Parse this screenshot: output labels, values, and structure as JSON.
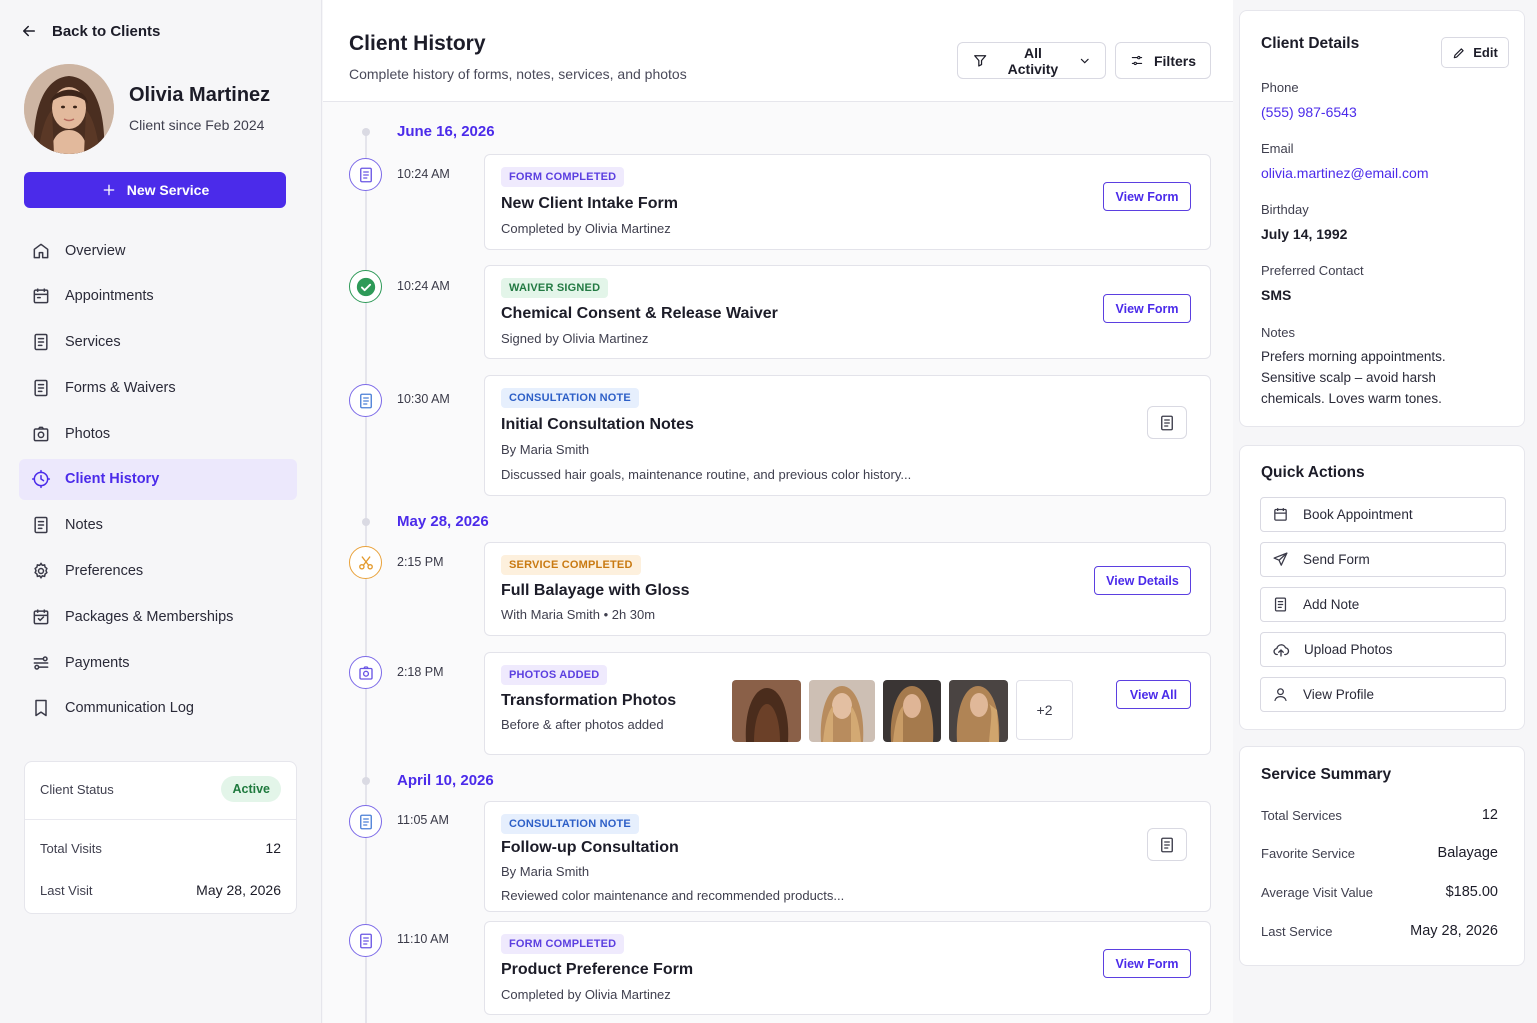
{
  "sidebar": {
    "back_label": "Back to Clients",
    "client_name": "Olivia Martinez",
    "client_since": "Client since Feb 2024",
    "new_service_label": "New Service",
    "nav": [
      {
        "label": "Overview",
        "icon": "home-icon"
      },
      {
        "label": "Appointments",
        "icon": "calendar-icon"
      },
      {
        "label": "Services",
        "icon": "document-icon"
      },
      {
        "label": "Forms & Waivers",
        "icon": "document-icon"
      },
      {
        "label": "Photos",
        "icon": "camera-icon"
      },
      {
        "label": "Client History",
        "icon": "history-icon",
        "active": true
      },
      {
        "label": "Notes",
        "icon": "document-icon"
      },
      {
        "label": "Preferences",
        "icon": "gear-icon"
      },
      {
        "label": "Packages & Memberships",
        "icon": "package-icon"
      },
      {
        "label": "Payments",
        "icon": "payments-icon"
      },
      {
        "label": "Communication Log",
        "icon": "bookmark-icon"
      }
    ],
    "status": {
      "status_label": "Client Status",
      "status_value": "Active",
      "visits_label": "Total Visits",
      "visits_value": "12",
      "last_visit_label": "Last Visit",
      "last_visit_value": "May 28, 2026"
    }
  },
  "main": {
    "title": "Client History",
    "subtitle": "Complete history of forms, notes, services, and photos",
    "activity_filter": "All Activity",
    "filters_label": "Filters",
    "dates": [
      "June 16, 2026",
      "May 28, 2026",
      "April 10, 2026"
    ],
    "entries": [
      {
        "time": "10:24 AM",
        "tag": "FORM COMPLETED",
        "title": "New Client Intake Form",
        "sub": "Completed by Olivia Martinez",
        "button": "View Form"
      },
      {
        "time": "10:24 AM",
        "tag": "WAIVER SIGNED",
        "title": "Chemical Consent & Release Waiver",
        "sub": "Signed by Olivia Martinez",
        "button": "View Form"
      },
      {
        "time": "10:30 AM",
        "tag": "CONSULTATION NOTE",
        "title": "Initial Consultation Notes",
        "sub": "By Maria Smith",
        "desc": "Discussed hair goals, maintenance routine, and previous color history..."
      },
      {
        "time": "2:15 PM",
        "tag": "SERVICE COMPLETED",
        "title": "Full Balayage with Gloss",
        "sub": "With Maria Smith  •  2h 30m",
        "button": "View Details"
      },
      {
        "time": "2:18 PM",
        "tag": "PHOTOS ADDED",
        "title": "Transformation Photos",
        "sub": "Before & after photos added",
        "button": "View All",
        "more": "+2"
      },
      {
        "time": "11:05 AM",
        "tag": "CONSULTATION NOTE",
        "title": "Follow-up Consultation",
        "sub": "By Maria Smith",
        "desc": "Reviewed color maintenance and recommended products..."
      },
      {
        "time": "11:10 AM",
        "tag": "FORM COMPLETED",
        "title": "Product Preference Form",
        "sub": "Completed by Olivia Martinez",
        "button": "View Form"
      }
    ]
  },
  "details": {
    "title": "Client Details",
    "edit_label": "Edit",
    "phone_label": "Phone",
    "phone": "(555) 987-6543",
    "email_label": "Email",
    "email": "olivia.martinez@email.com",
    "birthday_label": "Birthday",
    "birthday": "July 14, 1992",
    "contact_label": "Preferred Contact",
    "contact": "SMS",
    "notes_label": "Notes",
    "notes": "Prefers morning appointments. Sensitive scalp – avoid harsh chemicals. Loves warm tones."
  },
  "quick_actions": {
    "title": "Quick Actions",
    "items": [
      "Book Appointment",
      "Send Form",
      "Add Note",
      "Upload Photos",
      "View Profile"
    ]
  },
  "summary": {
    "title": "Service Summary",
    "rows": [
      {
        "label": "Total Services",
        "value": "12"
      },
      {
        "label": "Favorite Service",
        "value": "Balayage"
      },
      {
        "label": "Average Visit Value",
        "value": "$185.00"
      },
      {
        "label": "Last Service",
        "value": "May 28, 2026"
      }
    ]
  },
  "colors": {
    "accent": "#4b2bea",
    "success": "#2e9a58",
    "warning": "#e9a23b"
  }
}
